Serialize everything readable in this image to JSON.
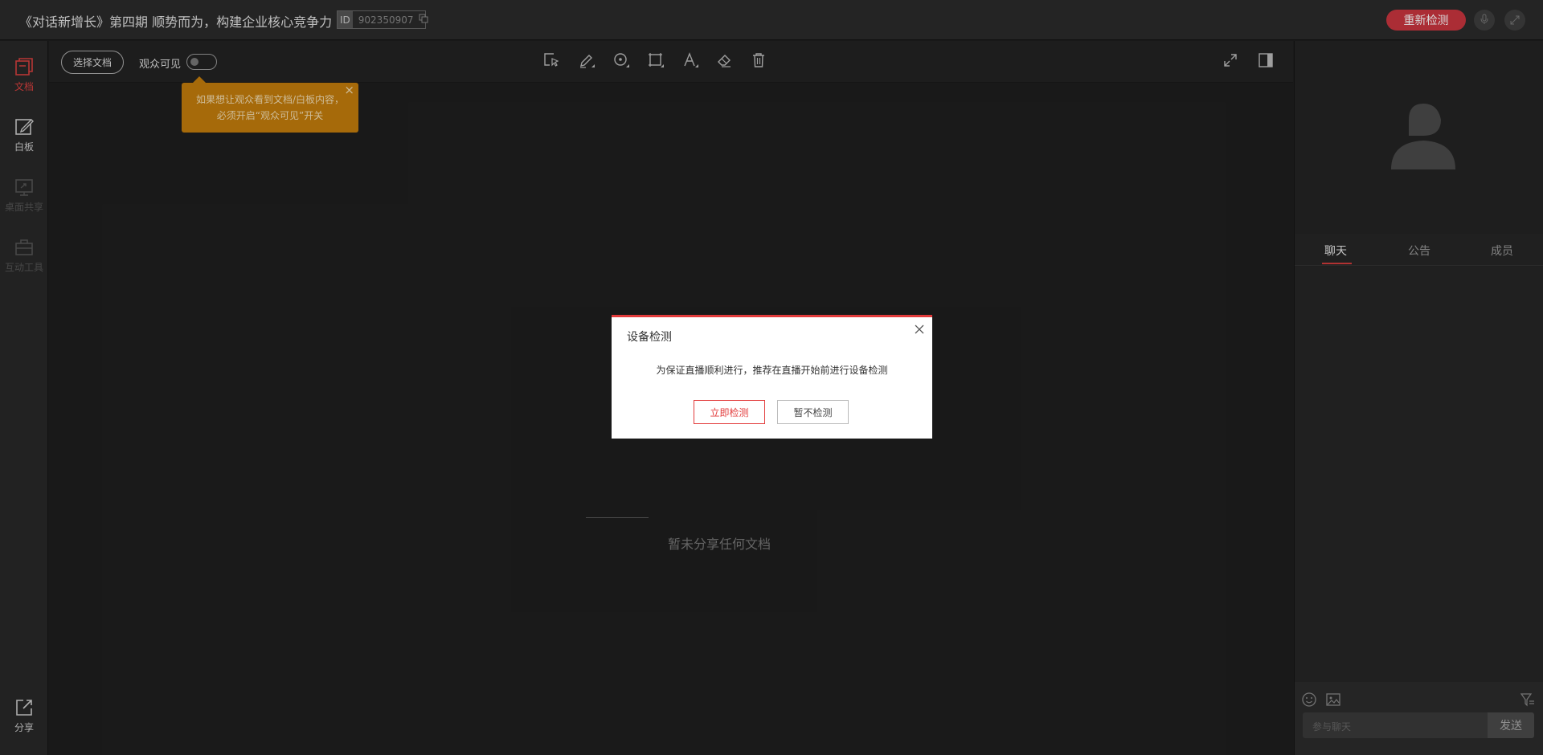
{
  "header": {
    "title": "《对话新增长》第四期 顺势而为，构建企业核心竞争力",
    "id_tag": "ID",
    "id_value": "902350907",
    "recheck_label": "重新检测"
  },
  "leftnav": {
    "items": [
      {
        "label": "文档",
        "icon": "document-icon",
        "active": true
      },
      {
        "label": "白板",
        "icon": "whiteboard-icon"
      },
      {
        "label": "桌面共享",
        "icon": "screen-share-icon"
      },
      {
        "label": "互动工具",
        "icon": "toolbox-icon"
      }
    ],
    "share_label": "分享"
  },
  "toolbar": {
    "choose_doc_label": "选择文档",
    "audience_visible_label": "观众可见"
  },
  "tooltip": {
    "line1": "如果想让观众看到文档/白板内容，",
    "line2": "必须开启“观众可见”开关"
  },
  "canvas": {
    "empty_text": "暂未分享任何文档"
  },
  "rightpanel": {
    "tabs": [
      {
        "label": "聊天",
        "active": true
      },
      {
        "label": "公告"
      },
      {
        "label": "成员"
      }
    ],
    "chat_placeholder": "参与聊天",
    "send_label": "发送"
  },
  "modal": {
    "title": "设备检测",
    "message": "为保证直播顺利进行，推荐在直播开始前进行设备检测",
    "confirm_label": "立即检测",
    "cancel_label": "暂不检测"
  },
  "colors": {
    "accent": "#e23b3b",
    "tooltip_bg": "#c47d0c",
    "background": "#1e1e1e"
  }
}
